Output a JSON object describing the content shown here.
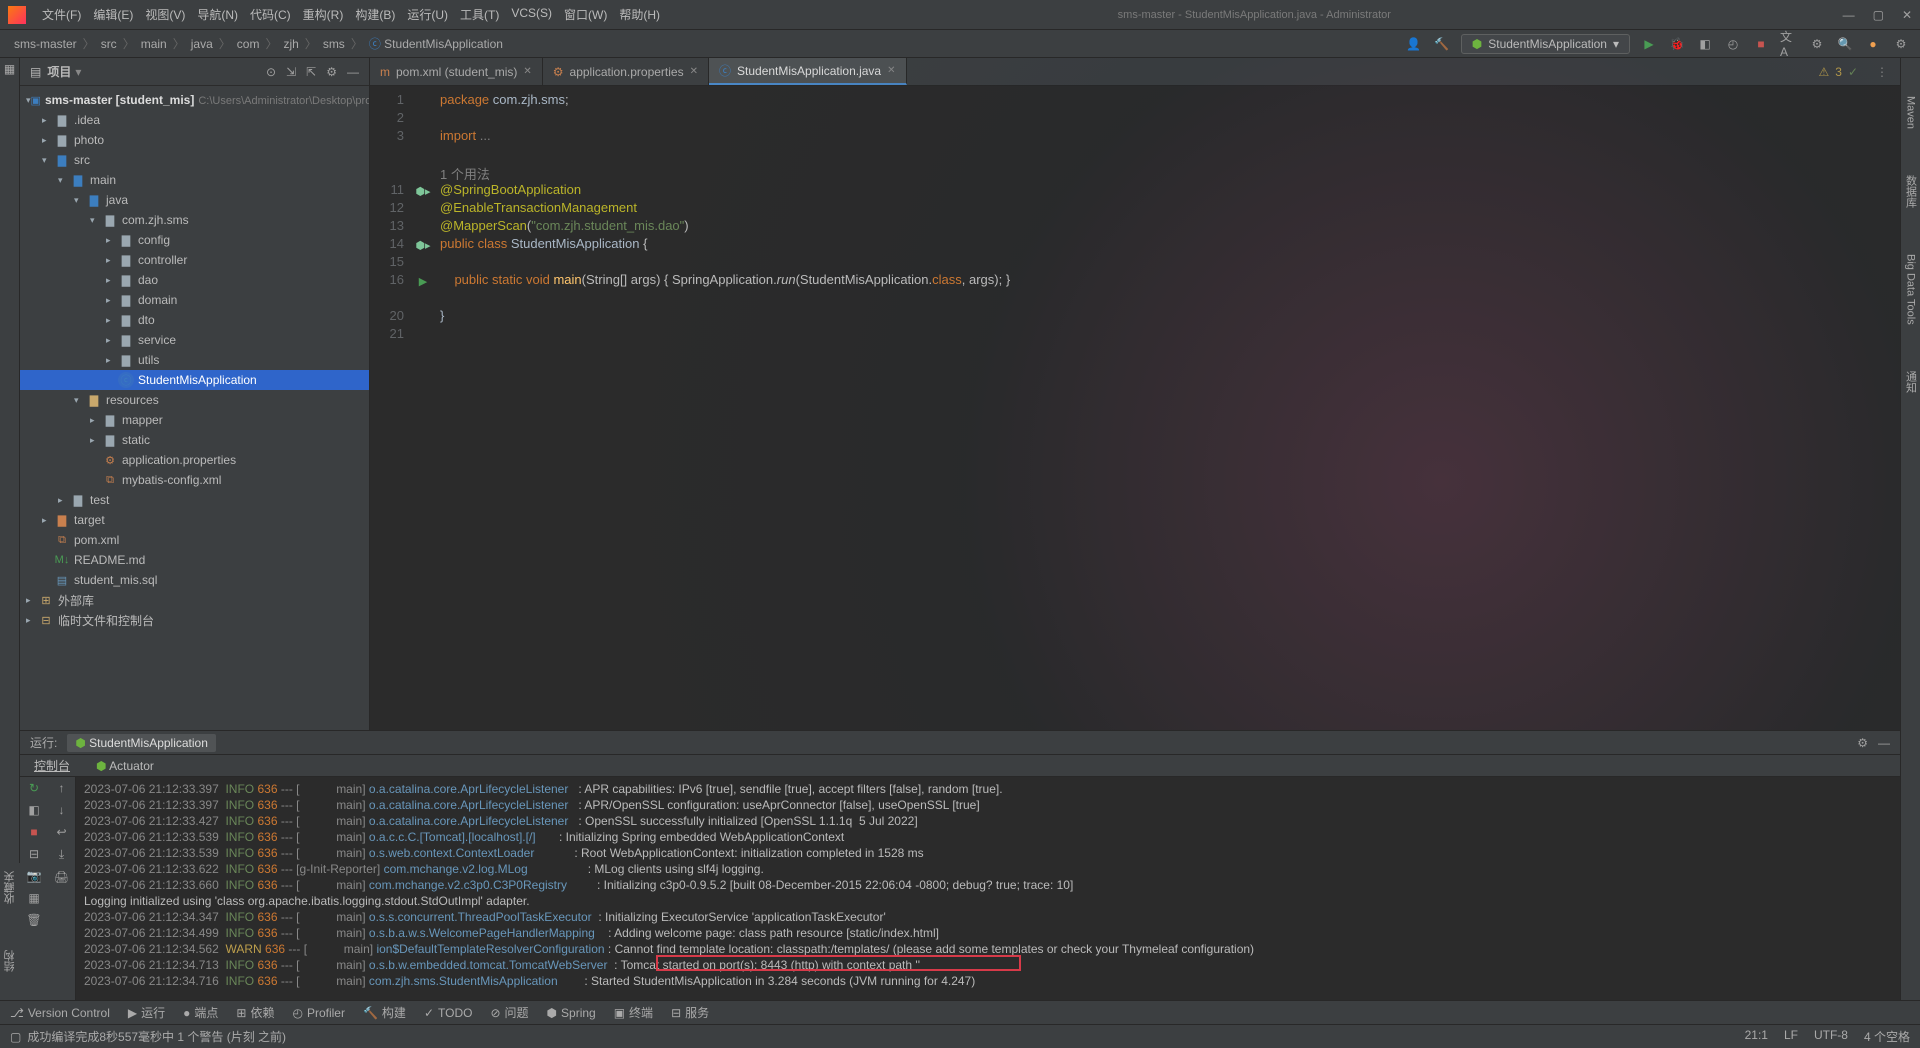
{
  "title": "sms-master - StudentMisApplication.java - Administrator",
  "menu": [
    "文件(F)",
    "编辑(E)",
    "视图(V)",
    "导航(N)",
    "代码(C)",
    "重构(R)",
    "构建(B)",
    "运行(U)",
    "工具(T)",
    "VCS(S)",
    "窗口(W)",
    "帮助(H)"
  ],
  "breadcrumbs": [
    "sms-master",
    "src",
    "main",
    "java",
    "com",
    "zjh",
    "sms",
    "StudentMisApplication"
  ],
  "run_config": "StudentMisApplication",
  "warnings": "3",
  "project": {
    "title": "项目",
    "root": {
      "name": "sms-master [student_mis]",
      "path": "C:\\Users\\Administrator\\Desktop\\project\\成绩管"
    },
    "items": [
      {
        "name": ".idea",
        "indent": 1,
        "icon": "folder",
        "exp": false
      },
      {
        "name": "photo",
        "indent": 1,
        "icon": "folder",
        "exp": false
      },
      {
        "name": "src",
        "indent": 1,
        "icon": "folder-src",
        "exp": true
      },
      {
        "name": "main",
        "indent": 2,
        "icon": "folder-src",
        "exp": true
      },
      {
        "name": "java",
        "indent": 3,
        "icon": "folder-src",
        "exp": true
      },
      {
        "name": "com.zjh.sms",
        "indent": 4,
        "icon": "folder",
        "exp": true
      },
      {
        "name": "config",
        "indent": 5,
        "icon": "folder",
        "exp": false
      },
      {
        "name": "controller",
        "indent": 5,
        "icon": "folder",
        "exp": false
      },
      {
        "name": "dao",
        "indent": 5,
        "icon": "folder",
        "exp": false
      },
      {
        "name": "domain",
        "indent": 5,
        "icon": "folder",
        "exp": false
      },
      {
        "name": "dto",
        "indent": 5,
        "icon": "folder",
        "exp": false
      },
      {
        "name": "service",
        "indent": 5,
        "icon": "folder",
        "exp": false
      },
      {
        "name": "utils",
        "indent": 5,
        "icon": "folder",
        "exp": false
      },
      {
        "name": "StudentMisApplication",
        "indent": 5,
        "icon": "class",
        "selected": true
      },
      {
        "name": "resources",
        "indent": 3,
        "icon": "folder-res",
        "exp": true
      },
      {
        "name": "mapper",
        "indent": 4,
        "icon": "folder",
        "exp": false
      },
      {
        "name": "static",
        "indent": 4,
        "icon": "folder",
        "exp": false
      },
      {
        "name": "application.properties",
        "indent": 4,
        "icon": "props"
      },
      {
        "name": "mybatis-config.xml",
        "indent": 4,
        "icon": "xml"
      },
      {
        "name": "test",
        "indent": 2,
        "icon": "folder",
        "exp": false
      },
      {
        "name": "target",
        "indent": 1,
        "icon": "folder-target",
        "exp": false
      },
      {
        "name": "pom.xml",
        "indent": 1,
        "icon": "xml"
      },
      {
        "name": "README.md",
        "indent": 1,
        "icon": "md"
      },
      {
        "name": "student_mis.sql",
        "indent": 1,
        "icon": "sql"
      }
    ],
    "ext_libs": "外部库",
    "scratch": "临时文件和控制台"
  },
  "tabs": [
    {
      "name": "pom.xml (student_mis)",
      "active": false,
      "icon": "xml"
    },
    {
      "name": "application.properties",
      "active": false,
      "icon": "props"
    },
    {
      "name": "StudentMisApplication.java",
      "active": true,
      "icon": "class"
    }
  ],
  "code": {
    "lines": [
      {
        "n": 1,
        "t": "package com.zjh.sms;",
        "k": "pkg"
      },
      {
        "n": 2,
        "t": ""
      },
      {
        "n": 3,
        "t": "import ...",
        "k": "imp"
      },
      {
        "n": "",
        "t": ""
      },
      {
        "n": "",
        "t": "1 个用法",
        "k": "hint"
      },
      {
        "n": 11,
        "t": "@SpringBootApplication",
        "k": "ann",
        "run": true
      },
      {
        "n": 12,
        "t": "@EnableTransactionManagement",
        "k": "ann"
      },
      {
        "n": 13,
        "t": "@MapperScan(\"com.zjh.student_mis.dao\")",
        "k": "annstr"
      },
      {
        "n": 14,
        "t": "public class StudentMisApplication {",
        "k": "cls",
        "run": true
      },
      {
        "n": 15,
        "t": ""
      },
      {
        "n": 16,
        "t": "    public static void main(String[] args) { SpringApplication.run(StudentMisApplication.class, args); }",
        "k": "meth",
        "play": true
      },
      {
        "n": "",
        "t": ""
      },
      {
        "n": 20,
        "t": "}"
      },
      {
        "n": 21,
        "t": ""
      }
    ]
  },
  "run": {
    "title": "运行:",
    "tab": "StudentMisApplication",
    "subtabs": [
      "控制台",
      "Actuator"
    ],
    "logs": [
      {
        "ts": "2023-07-06 21:12:33.397",
        "lvl": "INFO",
        "pid": "636",
        "thread": "main",
        "logger": "o.a.catalina.core.AprLifecycleListener",
        "msg": ": APR capabilities: IPv6 [true], sendfile [true], accept filters [false], random [true]."
      },
      {
        "ts": "2023-07-06 21:12:33.397",
        "lvl": "INFO",
        "pid": "636",
        "thread": "main",
        "logger": "o.a.catalina.core.AprLifecycleListener",
        "msg": ": APR/OpenSSL configuration: useAprConnector [false], useOpenSSL [true]"
      },
      {
        "ts": "2023-07-06 21:12:33.427",
        "lvl": "INFO",
        "pid": "636",
        "thread": "main",
        "logger": "o.a.catalina.core.AprLifecycleListener",
        "msg": ": OpenSSL successfully initialized [OpenSSL 1.1.1q  5 Jul 2022]"
      },
      {
        "ts": "2023-07-06 21:12:33.539",
        "lvl": "INFO",
        "pid": "636",
        "thread": "main",
        "logger": "o.a.c.c.C.[Tomcat].[localhost].[/]",
        "msg": ": Initializing Spring embedded WebApplicationContext"
      },
      {
        "ts": "2023-07-06 21:12:33.539",
        "lvl": "INFO",
        "pid": "636",
        "thread": "main",
        "logger": "o.s.web.context.ContextLoader",
        "msg": ": Root WebApplicationContext: initialization completed in 1528 ms"
      },
      {
        "ts": "2023-07-06 21:12:33.622",
        "lvl": "INFO",
        "pid": "636",
        "thread": "g-Init-Reporter",
        "logger": "com.mchange.v2.log.MLog",
        "msg": ": MLog clients using slf4j logging."
      },
      {
        "ts": "2023-07-06 21:12:33.660",
        "lvl": "INFO",
        "pid": "636",
        "thread": "main",
        "logger": "com.mchange.v2.c3p0.C3P0Registry",
        "msg": ": Initializing c3p0-0.9.5.2 [built 08-December-2015 22:06:04 -0800; debug? true; trace: 10]"
      },
      {
        "raw": "Logging initialized using 'class org.apache.ibatis.logging.stdout.StdOutImpl' adapter."
      },
      {
        "ts": "2023-07-06 21:12:34.347",
        "lvl": "INFO",
        "pid": "636",
        "thread": "main",
        "logger": "o.s.s.concurrent.ThreadPoolTaskExecutor",
        "msg": ": Initializing ExecutorService 'applicationTaskExecutor'"
      },
      {
        "ts": "2023-07-06 21:12:34.499",
        "lvl": "INFO",
        "pid": "636",
        "thread": "main",
        "logger": "o.s.b.a.w.s.WelcomePageHandlerMapping",
        "msg": ": Adding welcome page: class path resource [static/index.html]"
      },
      {
        "ts": "2023-07-06 21:12:34.562",
        "lvl": "WARN",
        "pid": "636",
        "thread": "main",
        "logger": "ion$DefaultTemplateResolverConfiguration",
        "msg": ": Cannot find template location: classpath:/templates/ (please add some templates or check your Thymeleaf configuration)"
      },
      {
        "ts": "2023-07-06 21:12:34.713",
        "lvl": "INFO",
        "pid": "636",
        "thread": "main",
        "logger": "o.s.b.w.embedded.tomcat.TomcatWebServer",
        "msg": ": Tomcat started on port(s): 8443 (http) with context path ''",
        "hl": true
      },
      {
        "ts": "2023-07-06 21:12:34.716",
        "lvl": "INFO",
        "pid": "636",
        "thread": "main",
        "logger": "com.zjh.sms.StudentMisApplication",
        "msg": ": Started StudentMisApplication in 3.284 seconds (JVM running for 4.247)"
      }
    ]
  },
  "bottom_tools": [
    "Version Control",
    "运行",
    "端点",
    "依赖",
    "Profiler",
    "构建",
    "TODO",
    "问题",
    "Spring",
    "终端",
    "服务"
  ],
  "status": {
    "left": "成功编译完成8秒557毫秒中 1 个警告 (片刻 之前)",
    "right": [
      "21:1",
      "LF",
      "UTF-8",
      "4 个空格"
    ]
  },
  "side_right": [
    "Maven",
    "数据库",
    "Big Data Tools",
    "通知"
  ],
  "side_left_bottom": [
    "收藏夹",
    "结构"
  ]
}
